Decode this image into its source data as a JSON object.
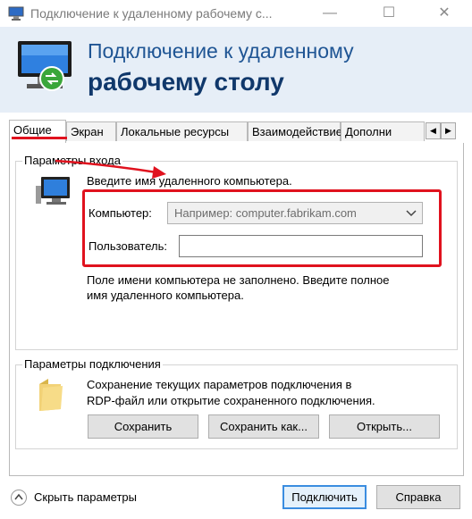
{
  "window": {
    "title": "Подключение к удаленному рабочему с...",
    "minimize_glyph": "—",
    "maximize_glyph": "☐",
    "close_glyph": "✕"
  },
  "banner": {
    "line1": "Подключение к удаленному",
    "line2": "рабочему столу"
  },
  "tabs": [
    {
      "label": "Общие",
      "active": true
    },
    {
      "label": "Экран"
    },
    {
      "label": "Локальные ресурсы"
    },
    {
      "label": "Взаимодействие"
    },
    {
      "label": "Дополни"
    }
  ],
  "tab_scroll": {
    "left": "◀",
    "right": "▶"
  },
  "login": {
    "group_label": "Параметры входа",
    "hint": "Введите имя удаленного компьютера.",
    "computer_label": "Компьютер:",
    "computer_placeholder": "Например: computer.fabrikam.com",
    "user_label": "Пользователь:",
    "user_value": "",
    "warning_line1": "Поле имени компьютера не заполнено. Введите полное",
    "warning_line2": "имя удаленного компьютера."
  },
  "connection": {
    "group_label": "Параметры подключения",
    "description_line1": "Сохранение текущих параметров подключения в",
    "description_line2": "RDP-файл или открытие сохраненного подключения.",
    "save_label": "Сохранить",
    "save_as_label": "Сохранить как...",
    "open_label": "Открыть..."
  },
  "footer": {
    "hide_label": "Скрыть параметры",
    "connect_label": "Подключить",
    "help_label": "Справка"
  },
  "colors": {
    "banner_bg": "#e6eef7",
    "title_blue": "#1f5594",
    "annotation_red": "#e0121e"
  }
}
